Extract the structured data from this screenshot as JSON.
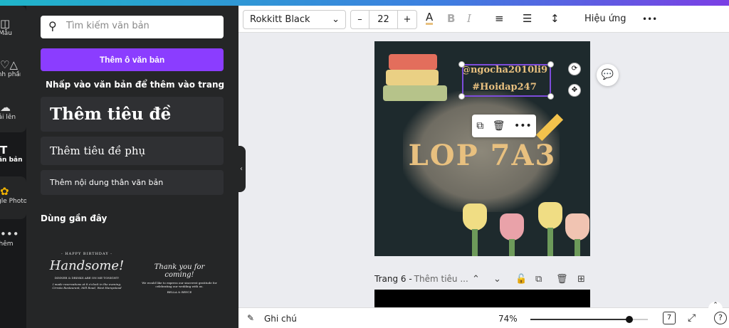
{
  "rail": {
    "items": [
      {
        "label": "Mẫu",
        "icon": "layout-icon"
      },
      {
        "label": "Thành phần",
        "icon": "elements-icon"
      },
      {
        "label": "Tải lên",
        "icon": "upload-icon"
      },
      {
        "label": "Văn bản",
        "icon": "text-icon"
      },
      {
        "label": "Google Photos",
        "icon": "google-photos-icon"
      },
      {
        "label": "Thêm",
        "icon": "more-icon"
      }
    ]
  },
  "panel": {
    "search_placeholder": "Tìm kiếm văn bản",
    "add_textbox": "Thêm ô văn bản",
    "hint": "Nhấp vào văn bản để thêm vào trang",
    "heading": "Thêm tiêu đề",
    "subheading": "Thêm tiêu đề phụ",
    "body": "Thêm nội dung thân văn bản",
    "recent_title": "Dùng gần đây",
    "recent": [
      {
        "top": "- HAPPY BIRTHDAY -",
        "main": "Handsome!",
        "sub": "DINNER & DRINKS ARE ON ME TONIGHT!",
        "small": "I made reservations at 8 o'clock in the evening. Cirrata Restaurant, Mill Road, West Hampstead"
      },
      {
        "main": "Thank you for coming!",
        "sub": "We would like to express our sincerest gratitude for celebrating our wedding with us.",
        "small": "BELLA & BRYCE"
      }
    ]
  },
  "toolbar": {
    "font": "Rokkitt Black",
    "font_size": "22",
    "minus": "–",
    "plus": "+",
    "effects": "Hiệu ứng",
    "more": "•••"
  },
  "design": {
    "title": "LOP 7A3",
    "line1": "@ngocha2010li9",
    "line2": "#Hoidap247"
  },
  "page6": {
    "label": "Trang 6 - ",
    "title": "Thêm tiêu ..."
  },
  "bottom": {
    "notes": "Ghi chú",
    "zoom": "74%",
    "zoom_value": 74,
    "page_count": "7",
    "help": "?"
  }
}
